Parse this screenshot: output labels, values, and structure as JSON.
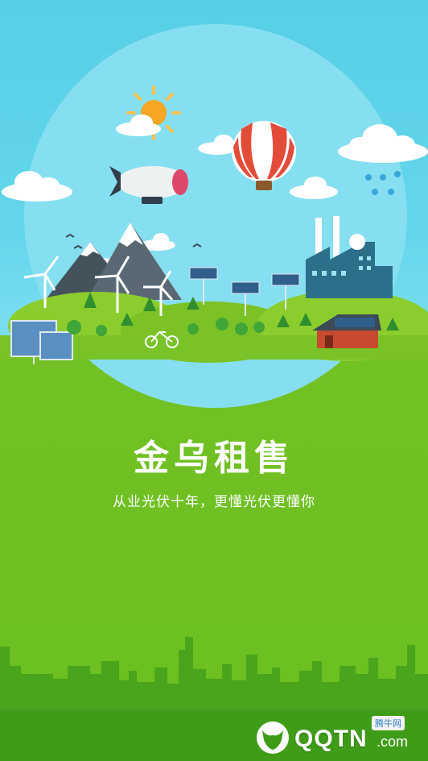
{
  "splash": {
    "app_title": "金乌租售",
    "tagline": "从业光伏十年，更懂光伏更懂你"
  },
  "watermark": {
    "brand": "QQTN",
    "domain": ".com",
    "badge": "腾牛网",
    "icon": "ox-head-logo"
  },
  "colors": {
    "sky": "#5fd4e9",
    "grass": "#6cc021",
    "skyline": "#4aa51c",
    "text": "#ffffff"
  }
}
